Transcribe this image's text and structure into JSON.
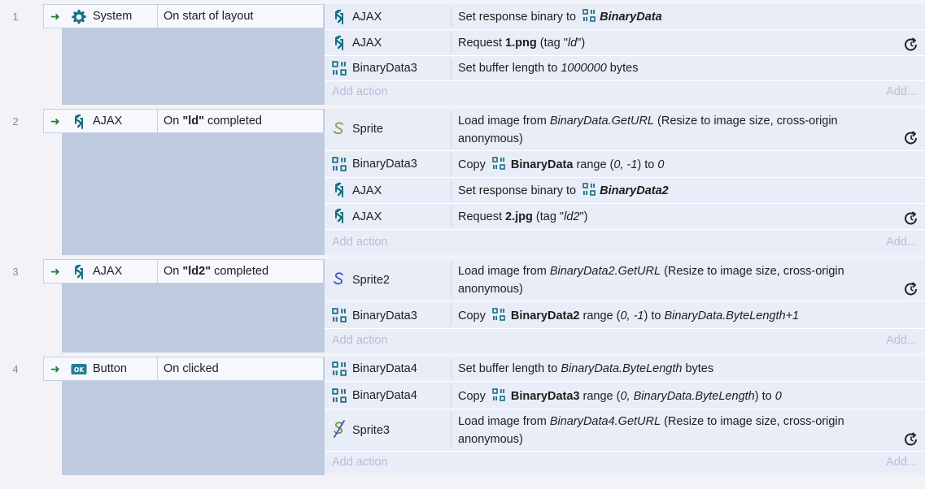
{
  "events": [
    {
      "number": "1",
      "condition": {
        "object": "System",
        "text": "On start of layout"
      },
      "actions": [
        {
          "object": "AJAX",
          "text_prefix": "Set response binary to",
          "ref": "BinaryData"
        },
        {
          "object": "AJAX",
          "text_prefix": "Request",
          "bold": "1.png",
          "middle": "(tag \"",
          "italic": "ld",
          "suffix": "\")"
        },
        {
          "object": "BinaryData3",
          "text_prefix": "Set buffer length to",
          "italic": "1000000",
          "suffix": "bytes"
        }
      ]
    },
    {
      "number": "2",
      "condition": {
        "object": "AJAX",
        "pre": "On",
        "bold": "\"ld\"",
        "post": "completed"
      },
      "actions": [
        {
          "object": "Sprite",
          "text_prefix": "Load image from",
          "italic": "BinaryData.GetURL",
          "suffix": "(Resize to image size, cross-origin anonymous)"
        },
        {
          "object": "BinaryData3",
          "text_prefix": "Copy",
          "ref": "BinaryData",
          "middle": "range (",
          "italic": "0, -1",
          "middle2": ") to",
          "italic2": "0"
        },
        {
          "object": "AJAX",
          "text_prefix": "Set response binary to",
          "ref": "BinaryData2"
        },
        {
          "object": "AJAX",
          "text_prefix": "Request",
          "bold": "2.jpg",
          "middle": "(tag \"",
          "italic": "ld2",
          "suffix": "\")"
        }
      ]
    },
    {
      "number": "3",
      "condition": {
        "object": "AJAX",
        "pre": "On",
        "bold": "\"ld2\"",
        "post": "completed"
      },
      "actions": [
        {
          "object": "Sprite2",
          "text_prefix": "Load image from",
          "italic": "BinaryData2.GetURL",
          "suffix": "(Resize to image size, cross-origin anonymous)"
        },
        {
          "object": "BinaryData3",
          "text_prefix": "Copy",
          "ref": "BinaryData2",
          "middle": "range (",
          "italic": "0, -1",
          "middle2": ") to",
          "italic2": "BinaryData.ByteLength+1"
        }
      ]
    },
    {
      "number": "4",
      "condition": {
        "object": "Button",
        "text": "On clicked",
        "icon_label": "OK"
      },
      "actions": [
        {
          "object": "BinaryData4",
          "text_prefix": "Set buffer length to",
          "italic": "BinaryData.ByteLength",
          "suffix": "bytes"
        },
        {
          "object": "BinaryData4",
          "text_prefix": "Copy",
          "ref": "BinaryData3",
          "middle": "range (",
          "italic": "0, BinaryData.ByteLength",
          "middle2": ") to",
          "italic2": "0"
        },
        {
          "object": "Sprite3",
          "text_prefix": "Load image from",
          "italic": "BinaryData4.GetURL",
          "suffix": "(Resize to image size, cross-origin anonymous)"
        }
      ]
    }
  ],
  "add_action_label": "Add action",
  "add_label": "Add...",
  "colors": {
    "ajax": "#1a6f80",
    "binary": "#1a6f80",
    "arrow": "#1e7c2a",
    "button_icon": "#1f7f9a"
  },
  "icons": {
    "system": "gear-icon",
    "ajax": "ajax-icon",
    "binary": "binary-data-icon",
    "sprite": "sprite-icon",
    "button": "button-icon",
    "trigger": "trigger-arrow-icon",
    "retrigger": "async-wait-icon"
  }
}
